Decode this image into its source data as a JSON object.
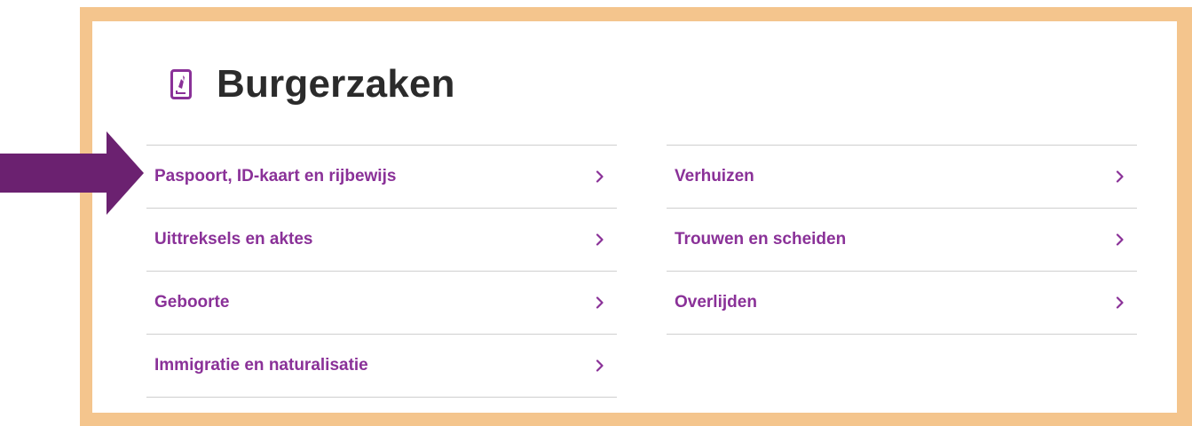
{
  "colors": {
    "frame": "#f4c58d",
    "accent": "#8a3198",
    "arrow": "#6b2170",
    "divider": "#cfcfcf",
    "title": "#2b2b2b"
  },
  "section": {
    "title": "Burgerzaken",
    "icon": "passport-icon"
  },
  "menu": {
    "left": [
      {
        "label": "Paspoort, ID-kaart en rijbewijs"
      },
      {
        "label": "Uittreksels en aktes"
      },
      {
        "label": "Geboorte"
      },
      {
        "label": "Immigratie en naturalisatie"
      }
    ],
    "right": [
      {
        "label": "Verhuizen"
      },
      {
        "label": "Trouwen en scheiden"
      },
      {
        "label": "Overlijden"
      }
    ]
  },
  "annotation": {
    "icon": "pointer-arrow-icon"
  }
}
